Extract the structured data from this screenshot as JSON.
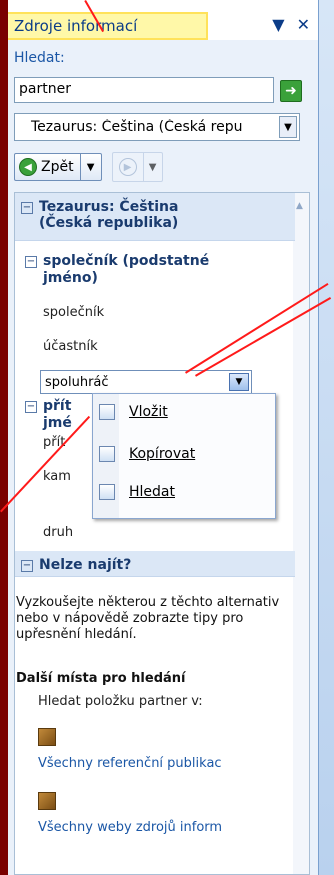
{
  "pane": {
    "title": "Zdroje informací",
    "search_label": "Hledat:",
    "search_value": "partner",
    "source": "Tezaurus: Čeština (Česká repu",
    "back_label": "Zpět"
  },
  "results": {
    "section_title_line1": "Tezaurus: Čeština",
    "section_title_line2": "(Česká republika)",
    "entry1_line1": "společník (podstatné",
    "entry1_line2": "jméno)",
    "syn1": "společník",
    "syn2": "účastník",
    "syn3": "spoluhráč",
    "entry2_a": "přít",
    "entry2_b": "jmé",
    "item_pri": "přít",
    "item_kam": "kam",
    "item_druh": "druh"
  },
  "menu": {
    "insert": "Vložit",
    "copy": "Kopírovat",
    "find": "Hledat"
  },
  "notfound": {
    "title": "Nelze najít?",
    "text": "Vyzkoušejte některou z těchto alternativ nebo v nápovědě zobrazte tipy pro upřesnění hledání.",
    "other_places": "Další místa pro hledání",
    "search_item": "Hledat položku partner v:",
    "link1": "Všechny referenční publikac",
    "link2": "Všechny weby zdrojů inform"
  }
}
